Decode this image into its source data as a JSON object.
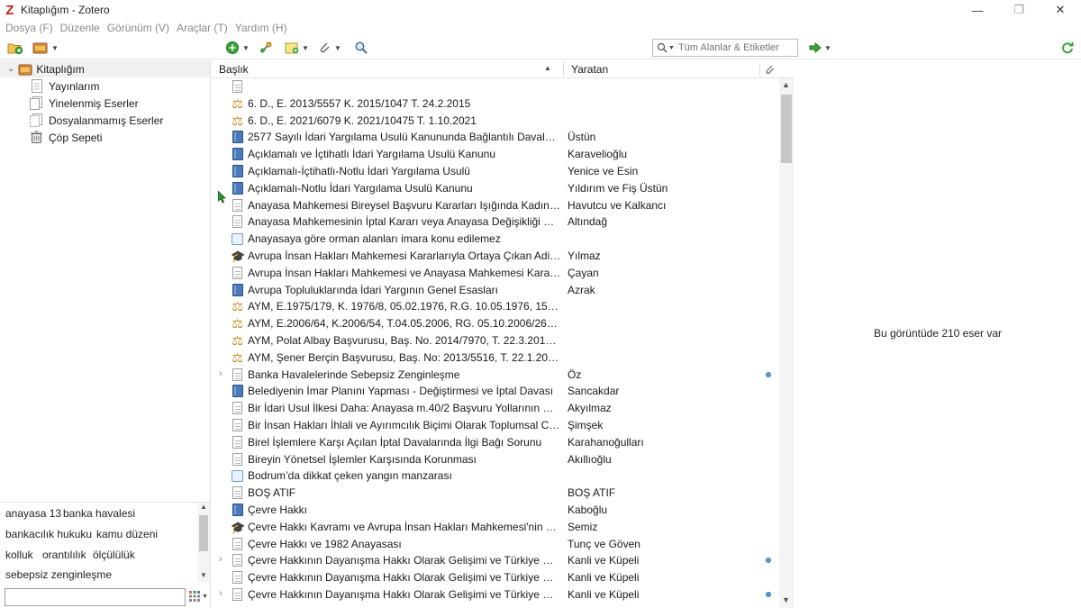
{
  "window": {
    "title": "Kitaplığım - Zotero",
    "logo_letter": "Z",
    "controls": [
      "—",
      "❐",
      "✕"
    ]
  },
  "menu": [
    "Dosya (F)",
    "Düzenle",
    "Görünüm (V)",
    "Araçlar (T)",
    "Yardım (H)"
  ],
  "toolbar": {
    "search_placeholder": "Tüm Alanlar & Etiketler",
    "icons": [
      "new-collection-icon",
      "new-library-icon",
      "new-item-icon",
      "add-by-identifier-icon",
      "new-note-icon",
      "attachment-icon",
      "advanced-search-icon",
      "locate-icon",
      "sync-icon"
    ]
  },
  "collections": [
    {
      "label": "Kitaplığım",
      "icon": "library-folder-icon",
      "selected": true
    },
    {
      "label": "Yayınlarım",
      "icon": "document-icon"
    },
    {
      "label": "Yinelenmiş Eserler",
      "icon": "duplicate-icon"
    },
    {
      "label": "Dosyalanmamış Eserler",
      "icon": "unfiled-icon"
    },
    {
      "label": "Çöp Sepeti",
      "icon": "trash-icon"
    }
  ],
  "tags": [
    "anayasa 13",
    "banka havalesi",
    "bankacılık hukuku",
    "kamu düzeni",
    "kolluk",
    "orantılılık",
    "ölçülülük",
    "sebepsiz zenginleşme"
  ],
  "columns": {
    "title": "Başlık",
    "creator": "Yaratan"
  },
  "items": [
    {
      "type": "document",
      "title": "",
      "creator": ""
    },
    {
      "type": "case",
      "title": "6. D., E. 2013/5557 K. 2015/1047 T. 24.2.2015",
      "creator": ""
    },
    {
      "type": "case",
      "title": "6. D., E. 2021/6079 K. 2021/10475 T. 1.10.2021",
      "creator": ""
    },
    {
      "type": "book",
      "title": "2577 Sayılı İdari Yargılama Usulü Kanununda Bağlantılı Davalar ve Aynı İşle…",
      "creator": "Üstün"
    },
    {
      "type": "book",
      "title": "Açıklamalı ve İçtihatlı İdari Yargılama Usulü Kanunu",
      "creator": "Karavelioğlu"
    },
    {
      "type": "book",
      "title": "Açıklamalı-İçtihatlı-Notlu İdari Yargılama Usulü",
      "creator": "Yenice ve Esin"
    },
    {
      "type": "book",
      "title": "Açıklamalı-Notlu İdari Yargılama Usulü Kanunu",
      "creator": "Yıldırım ve Fiş Üstün"
    },
    {
      "type": "document",
      "title": "Anayasa Mahkemesi Bireysel Başvuru Kararları Işığında Kadının Soyadı…",
      "creator": "Havutcu ve Kalkancı"
    },
    {
      "type": "document",
      "title": "Anayasa Mahkemesinin İptal Kararı veya Anayasa Değişikliği Sonrası…",
      "creator": "Altındağ"
    },
    {
      "type": "web",
      "title": "Anayasaya göre orman alanları imara konu edilemez",
      "creator": ""
    },
    {
      "type": "thesis",
      "title": "Avrupa İnsan Hakları Mahkemesi Kararlarıyla Ortaya Çıkan Adil Yargılanma…",
      "creator": "Yılmaz"
    },
    {
      "type": "document",
      "title": "Avrupa İnsan Hakları Mahkemesi ve Anayasa Mahkemesi Kararları Işığında…",
      "creator": "Çayan"
    },
    {
      "type": "book",
      "title": "Avrupa Topluluklarında İdari Yargının Genel Esasları",
      "creator": "Azrak"
    },
    {
      "type": "case",
      "title": "AYM, E.1975/179, K. 1976/8, 05.02.1976, R.G. 10.05.1976, 15583",
      "creator": ""
    },
    {
      "type": "case",
      "title": "AYM, E.2006/64, K.2006/54, T.04.05.2006, RG. 05.10.2006/26310",
      "creator": ""
    },
    {
      "type": "case",
      "title": "AYM, Polat Albay Başvurusu, Baş. No. 2014/7970, T. 22.3.2018 R.G., T…",
      "creator": ""
    },
    {
      "type": "case",
      "title": "AYM, Şener Berçin Başvurusu, Baş. No: 2013/5516, T. 22.1.2015, R.G.,…",
      "creator": ""
    },
    {
      "type": "document",
      "title": "Banka Havalelerinde Sebepsiz Zenginleşme",
      "creator": "Öz",
      "expandable": true,
      "dot": true
    },
    {
      "type": "book",
      "title": "Belediyenin İmar Planını Yapması - Değiştirmesi ve İptal Davası",
      "creator": "Sancakdar"
    },
    {
      "type": "document",
      "title": "Bir İdari Usul İlkesi Daha: Anayasa m.40/2 Başvuru Yollarının Gösterilmesi…",
      "creator": "Akyılmaz"
    },
    {
      "type": "document",
      "title": "Bir İnsan Hakları İhlali ve Ayırımcılık Biçimi Olarak Toplumsal Cinsiyet…",
      "creator": "Şimşek"
    },
    {
      "type": "document",
      "title": "Birel İşlemlere Karşı Açılan İptal Davalarında İlgi Bağı Sorunu",
      "creator": "Karahanoğulları"
    },
    {
      "type": "document",
      "title": "Bireyin Yönetsel İşlemler Karşısında Korunması",
      "creator": "Akıllıoğlu"
    },
    {
      "type": "web",
      "title": "Bodrum’da dikkat çeken yangın manzarası",
      "creator": ""
    },
    {
      "type": "document",
      "title": "BOŞ ATIF",
      "creator": "BOŞ ATIF"
    },
    {
      "type": "book",
      "title": "Çevre Hakkı",
      "creator": "Kaboğlu"
    },
    {
      "type": "thesis",
      "title": "Çevre Hakkı Kavramı ve Avrupa İnsan Hakları Mahkemesi'nin Çevre…",
      "creator": "Semiz"
    },
    {
      "type": "document",
      "title": "Çevre Hakkı ve 1982 Anayasası",
      "creator": "Tunç ve Göven"
    },
    {
      "type": "document",
      "title": "Çevre Hakkının Dayanışma Hakkı Olarak Gelişimi ve Türkiye Özelinde…",
      "creator": "Kanli ve Küpeli",
      "expandable": true,
      "dot": true
    },
    {
      "type": "document",
      "title": "Çevre Hakkının Dayanışma Hakkı Olarak Gelişimi ve Türkiye Özelinde…",
      "creator": "Kanli ve Küpeli"
    },
    {
      "type": "document",
      "title": "Çevre Hakkının Dayanışma Hakkı Olarak Gelişimi ve Türkiye Özelinde…",
      "creator": "Kanli ve Küpeli",
      "expandable": true,
      "dot": true
    }
  ],
  "item_pane": {
    "message": "Bu görüntüde 210 eser var"
  },
  "colors": {
    "accent": "#5b9bd5",
    "case_icon": "#c48a18",
    "book_icon": "#4a7ab8",
    "logo": "#c4201a"
  }
}
